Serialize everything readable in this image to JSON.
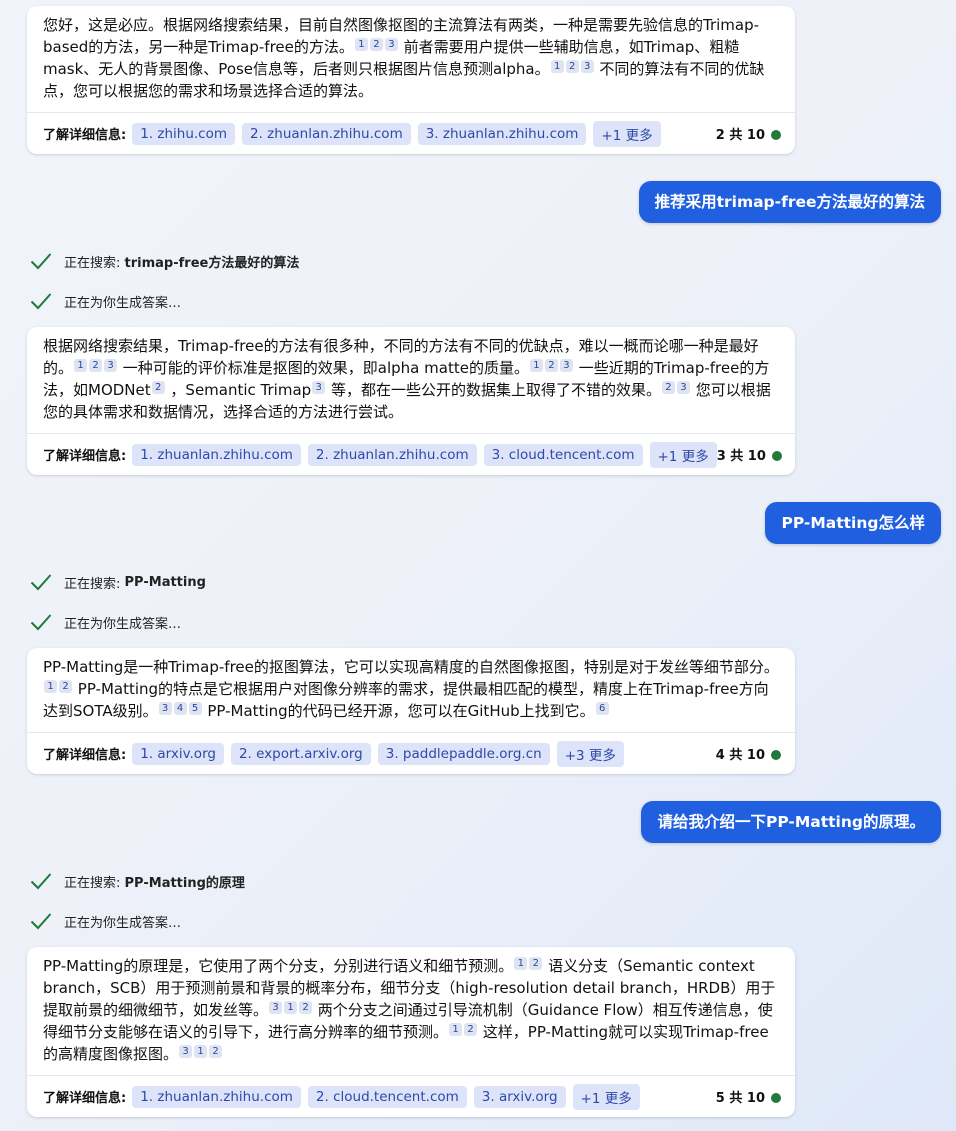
{
  "labels": {
    "learn_more": "了解详细信息:",
    "searching": "正在搜索:",
    "generating": "正在为你生成答案…"
  },
  "blocks": [
    {
      "answer_segments": [
        "您好，这是必应。根据网络搜索结果，目前自然图像抠图的主流算法有两类，一种是需要先验信息的Trimap-based的方法，另一种是Trimap-free的方法。",
        "前者需要用户提供一些辅助信息，如Trimap、粗糙mask、无人的背景图像、Pose信息等，后者则只根据图片信息预测alpha。",
        "不同的算法有不同的优缺点，您可以根据您的需求和场景选择合适的算法。"
      ],
      "citations": [
        [
          "1",
          "2",
          "3"
        ],
        [
          "1",
          "2",
          "3"
        ]
      ],
      "sources": [
        "1. zhihu.com",
        "2. zhuanlan.zhihu.com",
        "3. zhuanlan.zhihu.com"
      ],
      "more": "+1 更多",
      "count": "2 共 10"
    },
    {
      "user": "推荐采用trimap-free方法最好的算法",
      "search_query": "trimap-free方法最好的算法",
      "answer_segments": [
        "根据网络搜索结果，Trimap-free的方法有很多种，不同的方法有不同的优缺点，难以一概而论哪一种是最好的。",
        "一种可能的评价标准是抠图的效果，即alpha matte的质量。",
        "一些近期的Trimap-free的方法，如MODNet",
        "，Semantic Trimap",
        "等，都在一些公开的数据集上取得了不错的效果。",
        "您可以根据您的具体需求和数据情况，选择合适的方法进行尝试。"
      ],
      "citations": [
        [
          "1",
          "2",
          "3"
        ],
        [
          "1",
          "2",
          "3"
        ],
        [
          "2"
        ],
        [
          "3"
        ],
        [
          "2",
          "3"
        ]
      ],
      "sources": [
        "1. zhuanlan.zhihu.com",
        "2. zhuanlan.zhihu.com",
        "3. cloud.tencent.com"
      ],
      "more": "+1 更多",
      "count": "3 共 10"
    },
    {
      "user": "PP-Matting怎么样",
      "search_query": "PP-Matting",
      "answer_segments": [
        "PP-Matting是一种Trimap-free的抠图算法，它可以实现高精度的自然图像抠图，特别是对于发丝等细节部分。",
        "PP-Matting的特点是它根据用户对图像分辨率的需求，提供最相匹配的模型，精度上在Trimap-free方向达到SOTA级别。",
        "PP-Matting的代码已经开源，您可以在GitHub上找到它。"
      ],
      "citations": [
        [
          "1",
          "2"
        ],
        [
          "3",
          "4",
          "5"
        ],
        [
          "6"
        ]
      ],
      "sources": [
        "1. arxiv.org",
        "2. export.arxiv.org",
        "3. paddlepaddle.org.cn"
      ],
      "more": "+3 更多",
      "count": "4 共 10"
    },
    {
      "user": "请给我介绍一下PP-Matting的原理。",
      "search_query": "PP-Matting的原理",
      "answer_segments": [
        "PP-Matting的原理是，它使用了两个分支，分别进行语义和细节预测。",
        "语义分支（Semantic context branch，SCB）用于预测前景和背景的概率分布，细节分支（high-resolution detail branch，HRDB）用于提取前景的细微细节，如发丝等。",
        "两个分支之间通过引导流机制（Guidance Flow）相互传递信息，使得细节分支能够在语义的引导下，进行高分辨率的细节预测。",
        "这样，PP-Matting就可以实现Trimap-free的高精度图像抠图。"
      ],
      "citations": [
        [
          "1",
          "2"
        ],
        [
          "3",
          "1",
          "2"
        ],
        [
          "1",
          "2"
        ],
        [
          "3",
          "1",
          "2"
        ]
      ],
      "sources": [
        "1. zhuanlan.zhihu.com",
        "2. cloud.tencent.com",
        "3. arxiv.org"
      ],
      "more": "+1 更多",
      "count": "5 共 10"
    }
  ],
  "colors": {
    "accent": "#1f5fe0",
    "check": "#1e7a3a",
    "chip_bg": "#dde4f9",
    "chip_text": "#2e49a7"
  }
}
